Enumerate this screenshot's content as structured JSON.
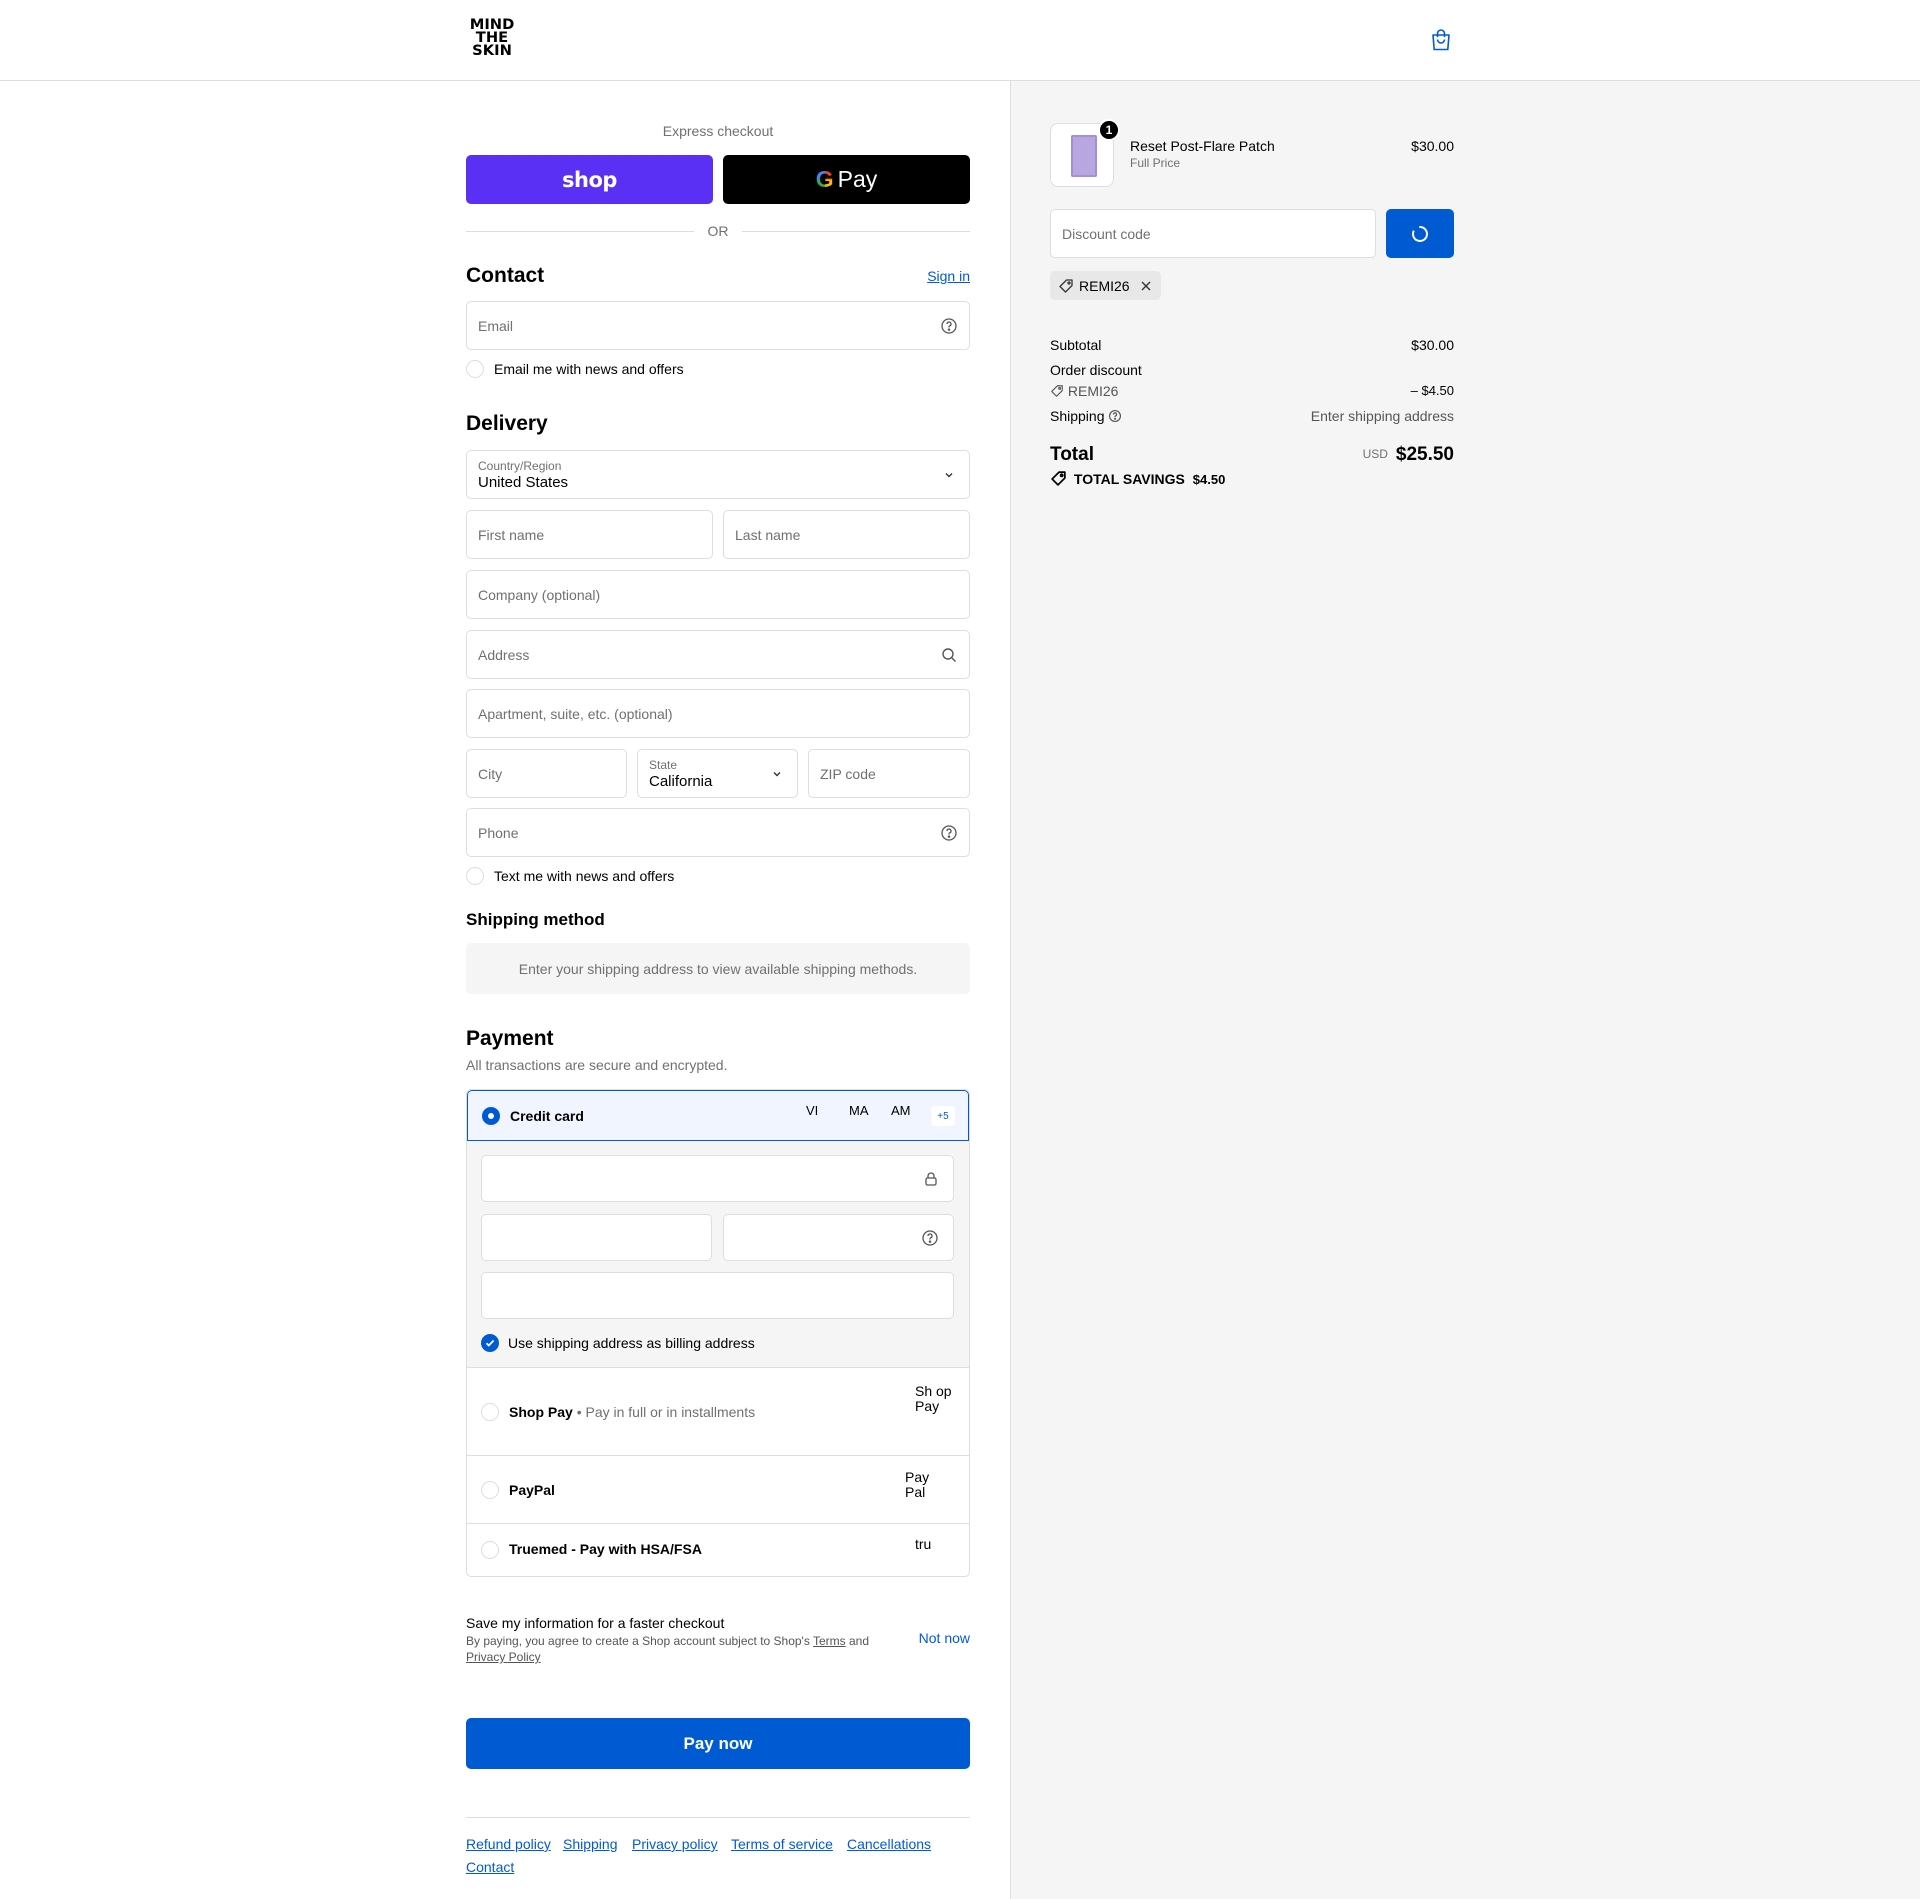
{
  "header": {
    "logo_lines": [
      "MIND",
      "THE",
      "SKIN"
    ]
  },
  "express": {
    "title": "Express checkout",
    "shop_label": "shop",
    "gpay_g": "G",
    "gpay_label": "Pay",
    "or": "OR"
  },
  "contact": {
    "title": "Contact",
    "sign_in": "Sign in",
    "email_placeholder": "Email",
    "news_label": "Email me with news and offers"
  },
  "delivery": {
    "title": "Delivery",
    "country_label": "Country/Region",
    "country_value": "United States",
    "first_name": "First name",
    "last_name": "Last name",
    "company": "Company (optional)",
    "address": "Address",
    "apartment": "Apartment, suite, etc. (optional)",
    "city": "City",
    "state_label": "State",
    "state_value": "California",
    "zip": "ZIP code",
    "phone": "Phone",
    "text_label": "Text me with news and offers"
  },
  "shipping": {
    "title": "Shipping method",
    "info": "Enter your shipping address to view available shipping methods."
  },
  "payment": {
    "title": "Payment",
    "subtitle": "All transactions are secure and encrypted.",
    "credit_card": "Credit card",
    "brands": [
      "VISA",
      "MASTER",
      "AMEX"
    ],
    "brand_alts": [
      "VI SA",
      "MA STER",
      "AM EX"
    ],
    "more_brands": "+5",
    "billing_label": "Use shipping address as billing address",
    "shop_pay": "Shop Pay",
    "shop_pay_sub": "• Pay in full or in installments",
    "shop_pay_alt": "Sh op Pay",
    "paypal": "PayPal",
    "paypal_alt": "Pay Pal",
    "truemed": "Truemed - Pay with HSA/FSA",
    "truemed_alt": "tru"
  },
  "save_info": {
    "title": "Save my information for a faster checkout",
    "legal_1": "By paying, you agree to create a Shop account subject to Shop's",
    "terms": "Terms",
    "and": "and",
    "privacy": "Privacy Policy",
    "not_now": "Not now"
  },
  "pay_now": "Pay now",
  "footer": {
    "links": [
      "Refund policy",
      "Shipping",
      "Privacy policy",
      "Terms of service",
      "Cancellations",
      "Contact"
    ]
  },
  "summary": {
    "product_name": "Reset Post-Flare Patch",
    "product_variant": "Full Price",
    "product_price": "$30.00",
    "quantity": "1",
    "discount_placeholder": "Discount code",
    "discount_code": "REMI26",
    "subtotal_label": "Subtotal",
    "subtotal_value": "$30.00",
    "order_discount_label": "Order discount",
    "discount_value": "– $4.50",
    "shipping_label": "Shipping",
    "shipping_value": "Enter shipping address",
    "total_label": "Total",
    "currency": "USD",
    "total_value": "$25.50",
    "savings_label": "TOTAL SAVINGS",
    "savings_value": "$4.50"
  },
  "colors": {
    "accent": "#005bd3",
    "shop_purple": "#5a31f4",
    "border": "#dedede",
    "summary_bg": "#f5f5f5"
  }
}
